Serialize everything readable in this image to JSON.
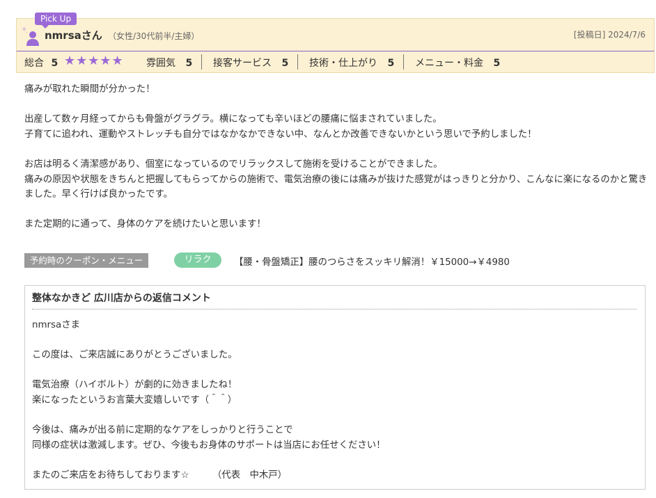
{
  "review": {
    "badge": "Pick Up",
    "user_name": "nmrsaさん",
    "user_attr": "（女性/30代前半/主婦）",
    "post_date": "[投稿日] 2024/7/6",
    "ratings": {
      "overall_label": "総合",
      "overall_value": "5",
      "stars_text": "★★★★★",
      "star_color": "#9b6ad6",
      "atmosphere_label": "雰囲気",
      "atmosphere_value": "5",
      "service_label": "接客サービス",
      "service_value": "5",
      "technique_label": "技術・仕上がり",
      "technique_value": "5",
      "menu_label": "メニュー・料金",
      "menu_value": "5"
    },
    "body": "痛みが取れた瞬間が分かった！\n\n出産して数ヶ月経ってからも骨盤がグラグラ。横になっても辛いほどの腰痛に悩まされていました。\n子育てに追われ、運動やストレッチも自分ではなかなかできない中、なんとか改善できないかという思いで予約しました！\n\nお店は明るく清潔感があり、個室になっているのでリラックスして施術を受けることができました。\n痛みの原因や状態をきちんと把握してもらってからの施術で、電気治療の後には痛みが抜けた感覚がはっきりと分かり、こんなに楽になるのかと驚きました。早く行けば良かったです。\n\nまた定期的に通って、身体のケアを続けたいと思います！",
    "coupon": {
      "label": "予約時のクーポン・メニュー",
      "tag": "リラク",
      "text": "【腰・骨盤矯正】腰のつらさをスッキリ解消！￥15000→￥4980"
    },
    "reply": {
      "title": "整体なかきど 広川店からの返信コメント",
      "body": "nmrsaさま\n\nこの度は、ご来店誠にありがとうございました。\n\n電気治療（ハイボルト）が劇的に効きましたね！\n楽になったというお言葉大変嬉しいです（＾＾）\n\n今後は、痛みが出る前に定期的なケアをしっかりと行うことで\n同様の症状は激減します。ぜひ、今後もお身体のサポートは当店にお任せください！\n\nまたのご来店をお待ちしております☆　　　（代表　中木戸）"
    }
  },
  "colors": {
    "header_bg": "#fdf1d3",
    "accent_purple": "#9b6ad6",
    "coupon_label_bg": "#9a9a9a",
    "coupon_tag_bg": "#7fd1a5"
  }
}
